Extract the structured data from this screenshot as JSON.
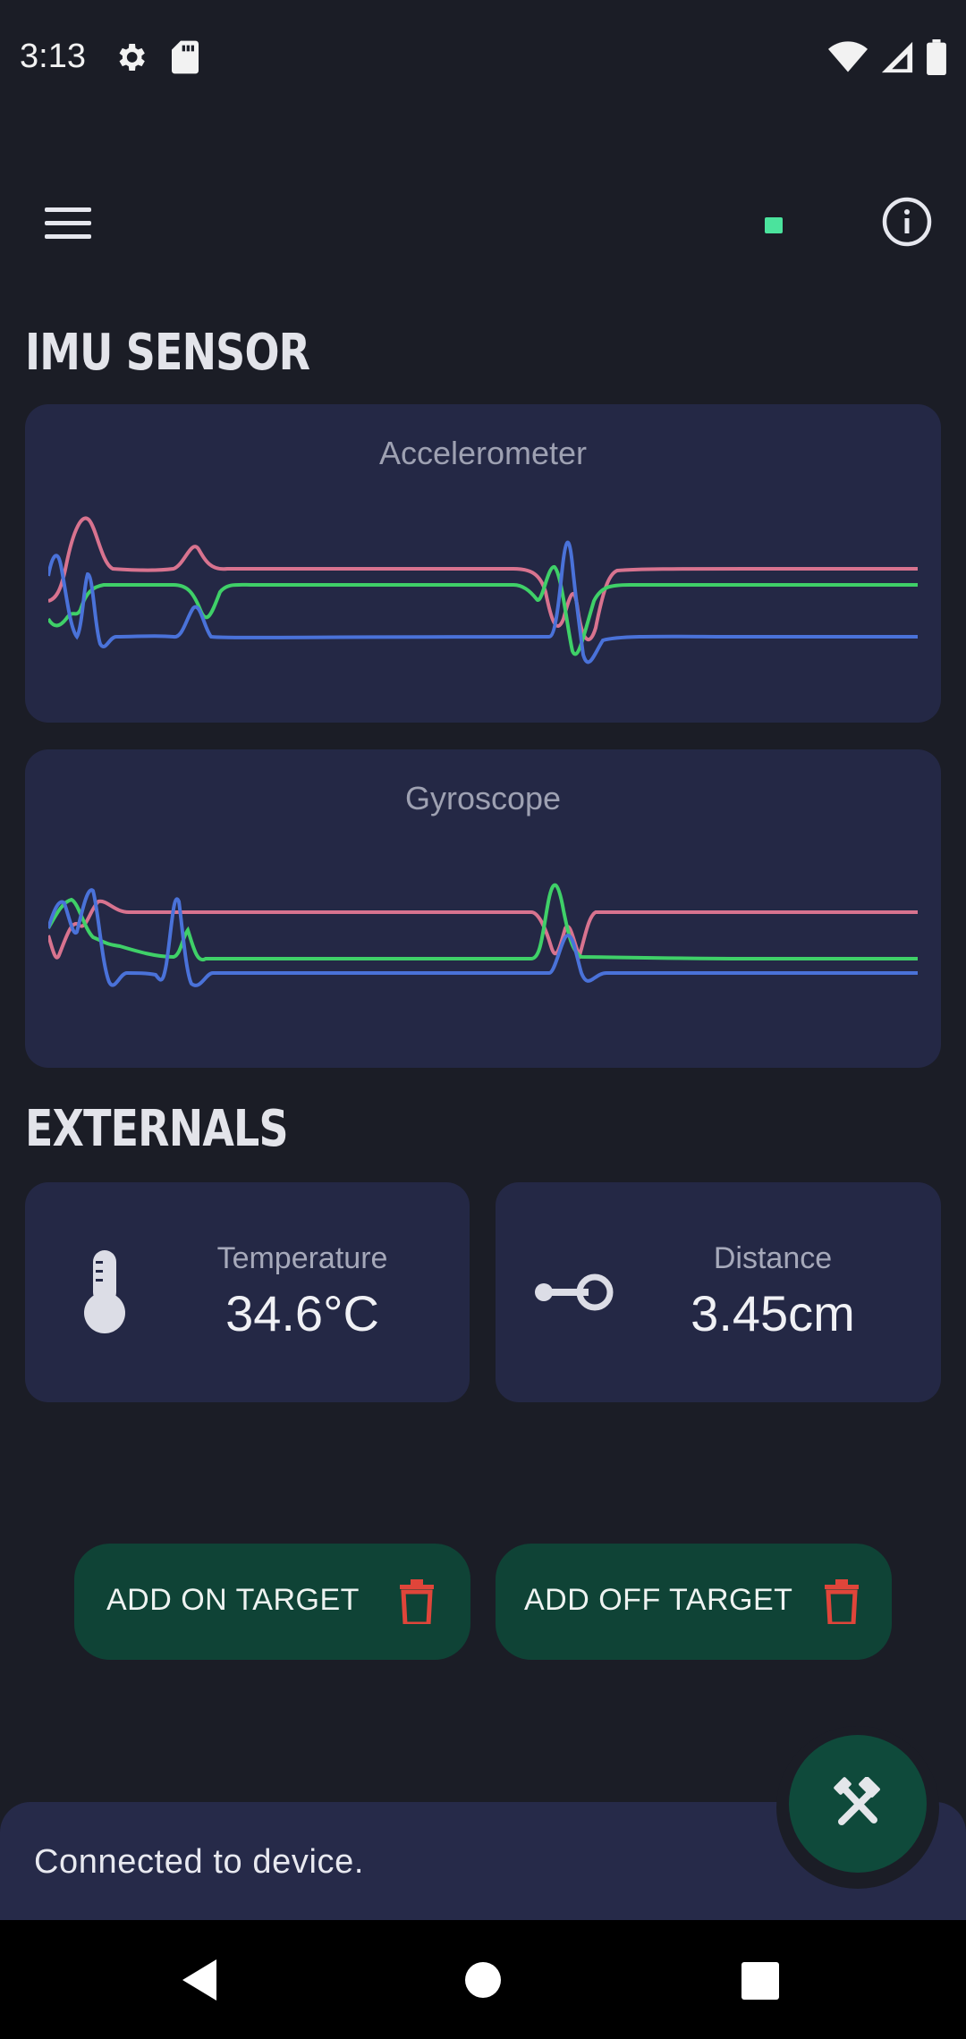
{
  "status_bar": {
    "time": "3:13",
    "icons": [
      "gear-icon",
      "sd-card-icon",
      "wifi-icon",
      "signal-icon",
      "battery-icon"
    ]
  },
  "app_bar": {
    "menu_icon": "menu-icon",
    "connection_indicator_color": "#4be39d",
    "info_icon": "info-icon"
  },
  "imu": {
    "section_title": "IMU SENSOR",
    "accelerometer": {
      "title": "Accelerometer",
      "series_colors": [
        "#d8738f",
        "#3fd068",
        "#4a72d9"
      ]
    },
    "gyroscope": {
      "title": "Gyroscope",
      "series_colors": [
        "#d8738f",
        "#3fd068",
        "#4a72d9"
      ]
    }
  },
  "externals": {
    "section_title": "EXTERNALS",
    "temperature": {
      "label": "Temperature",
      "value": "34.6°C",
      "icon": "thermometer-icon"
    },
    "distance": {
      "label": "Distance",
      "value": "3.45cm",
      "icon": "distance-icon"
    }
  },
  "actions": {
    "add_on_target": "ADD ON TARGET",
    "add_off_target": "ADD OFF TARGET",
    "delete_icon": "trash-icon",
    "delete_color": "#e0453a"
  },
  "snackbar": {
    "message": "Connected to device."
  },
  "fab": {
    "icon": "tools-icon"
  },
  "colors": {
    "background": "#1b1d26",
    "card": "#242845",
    "button": "#0f4336",
    "accent_green": "#4be39d"
  }
}
